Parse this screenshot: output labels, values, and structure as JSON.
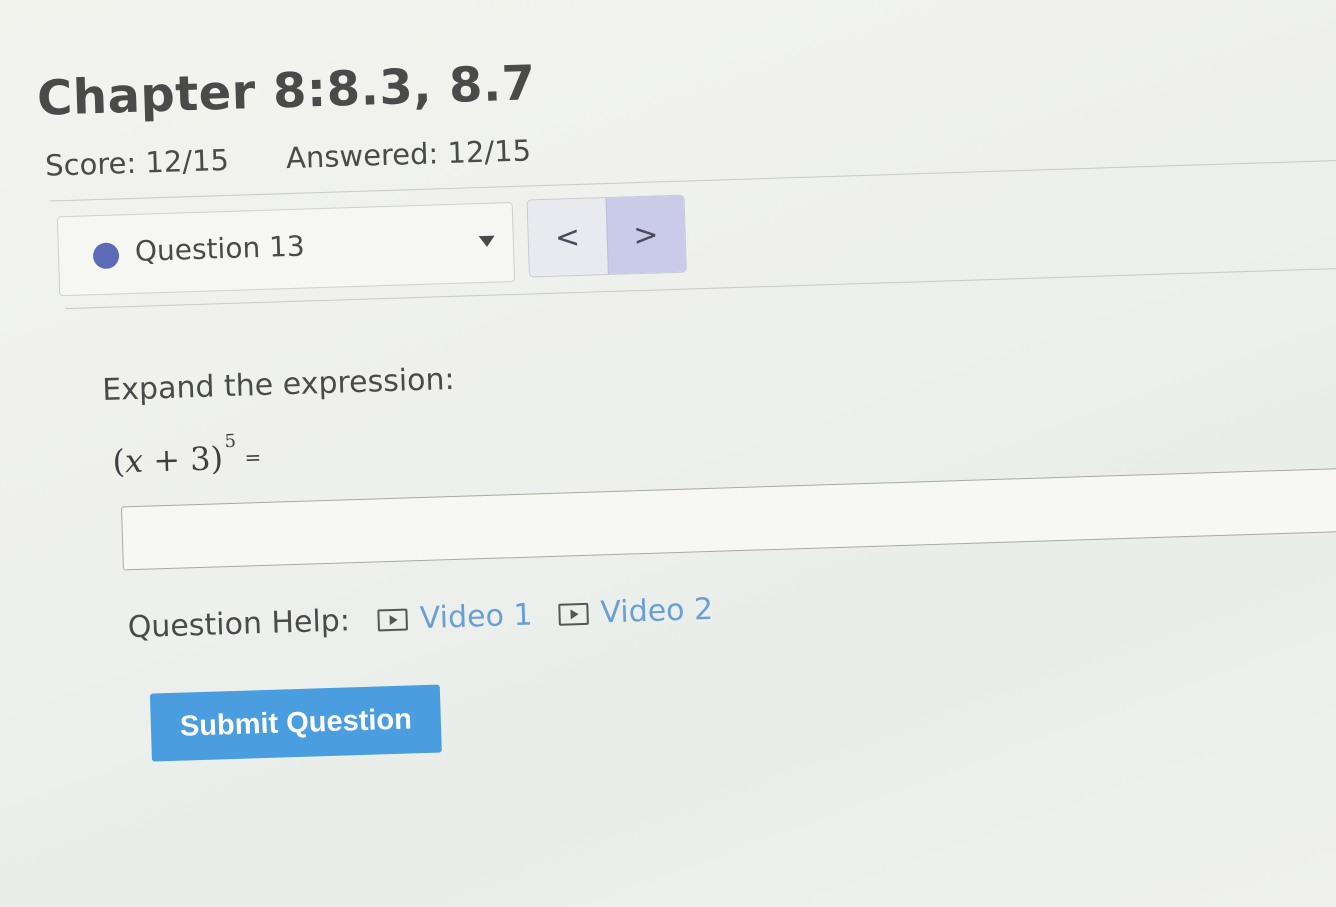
{
  "header": {
    "title": "Chapter 8:8.3, 8.7",
    "score": "Score: 12/15",
    "answered": "Answered: 12/15"
  },
  "question_nav": {
    "selected": "Question 13",
    "prev_label": "<",
    "next_label": ">"
  },
  "question": {
    "prompt": "Expand the expression:",
    "expr_open": "(",
    "expr_var": "x",
    "expr_rest": " + 3)",
    "expr_exponent": "5",
    "expr_equals": "=",
    "answer_value": ""
  },
  "help": {
    "label": "Question Help:",
    "links": [
      {
        "label": "Video 1",
        "icon": "video-play-icon"
      },
      {
        "label": "Video 2",
        "icon": "video-play-icon"
      }
    ]
  },
  "submit_label": "Submit Question",
  "colors": {
    "accent": "#4a9ee0",
    "link": "#6a9fd4",
    "status_dot": "#5b6bb5"
  }
}
